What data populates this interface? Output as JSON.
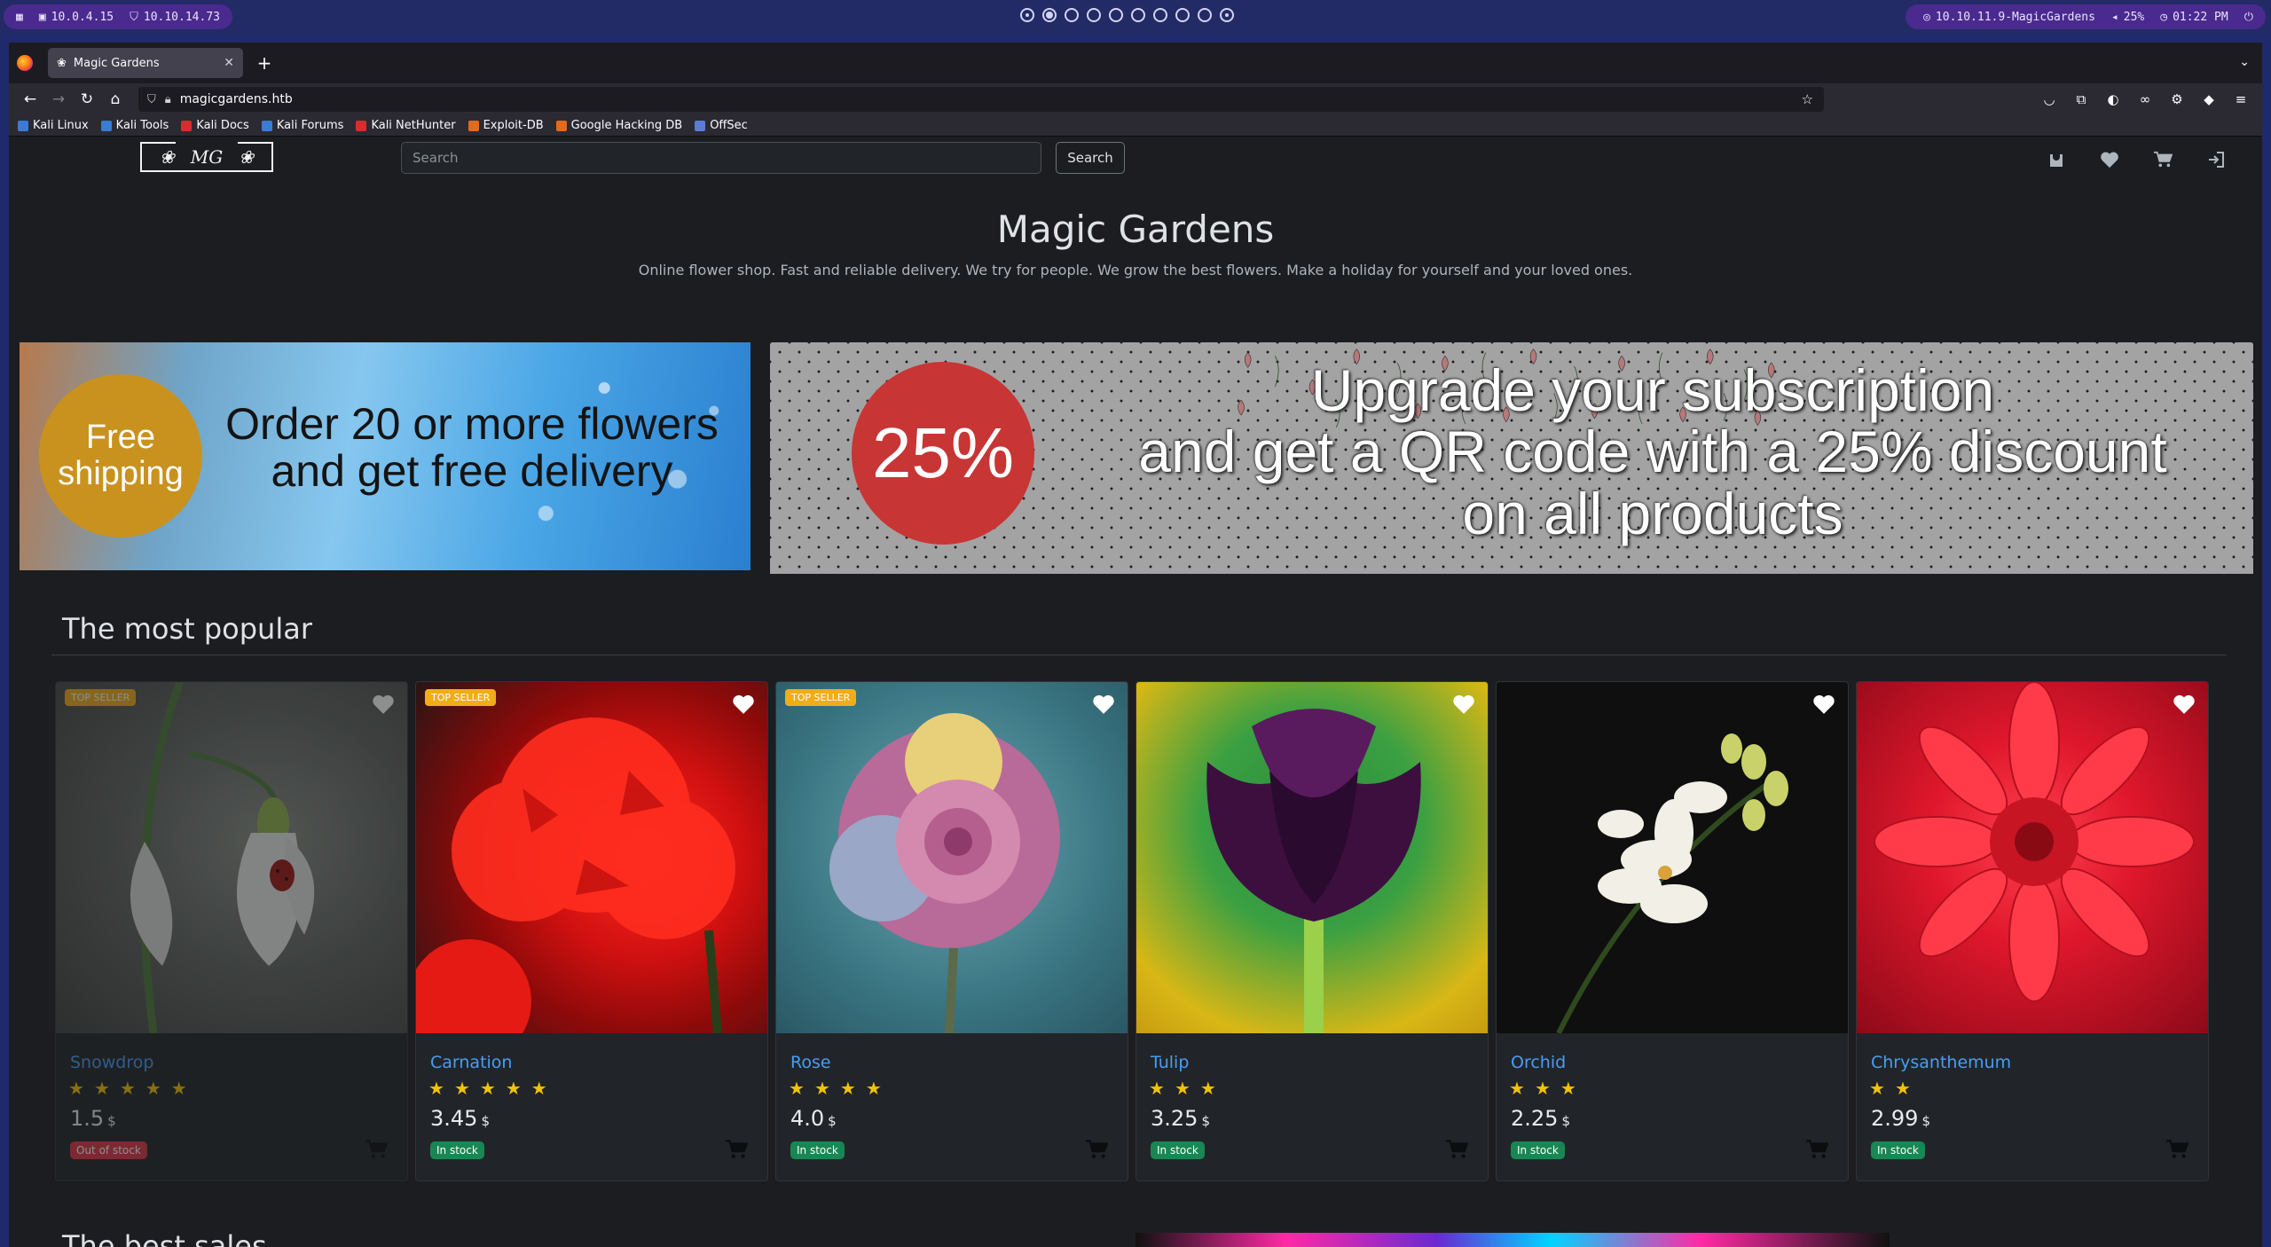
{
  "system": {
    "left_ips": [
      "10.0.4.15",
      "10.10.14.73"
    ],
    "target": "10.10.11.9-MagicGardens",
    "volume": "25%",
    "time": "01:22 PM"
  },
  "browser": {
    "tab_title": "Magic Gardens",
    "url": "magicgardens.htb",
    "bookmarks": [
      "Kali Linux",
      "Kali Tools",
      "Kali Docs",
      "Kali Forums",
      "Kali NetHunter",
      "Exploit-DB",
      "Google Hacking DB",
      "OffSec"
    ]
  },
  "site": {
    "search_placeholder": "Search",
    "search_button": "Search",
    "logo_text": "MG",
    "title": "Magic Gardens",
    "subtitle": "Online flower shop. Fast and reliable delivery. We try for people. We grow the best flowers. Make a holiday for yourself and your loved ones.",
    "banner_free": {
      "circle_line1": "Free",
      "circle_line2": "shipping",
      "text_line1": "Order 20 or more flowers",
      "text_line2": "and get free delivery"
    },
    "banner_sub": {
      "circle": "25%",
      "text_line1": "Upgrade your subscription",
      "text_line2": "and get a QR code with a 25% discount",
      "text_line3": "on all products"
    },
    "section_title": "The most popular",
    "next_section_title": "The best sales"
  },
  "products": [
    {
      "name": "Snowdrop",
      "rating": 5,
      "price": "1.5",
      "currency": "$",
      "stock": "Out of stock",
      "top_seller": "TOP SELLER",
      "badge": true,
      "in_stock": false
    },
    {
      "name": "Carnation",
      "rating": 5,
      "price": "3.45",
      "currency": "$",
      "stock": "In stock",
      "top_seller": "TOP SELLER",
      "badge": true,
      "in_stock": true
    },
    {
      "name": "Rose",
      "rating": 4,
      "price": "4.0",
      "currency": "$",
      "stock": "In stock",
      "top_seller": "TOP SELLER",
      "badge": true,
      "in_stock": true
    },
    {
      "name": "Tulip",
      "rating": 3,
      "price": "3.25",
      "currency": "$",
      "stock": "In stock",
      "top_seller": "",
      "badge": false,
      "in_stock": true
    },
    {
      "name": "Orchid",
      "rating": 3,
      "price": "2.25",
      "currency": "$",
      "stock": "In stock",
      "top_seller": "",
      "badge": false,
      "in_stock": true
    },
    {
      "name": "Chrysanthemum",
      "rating": 2,
      "price": "2.99",
      "currency": "$",
      "stock": "In stock",
      "top_seller": "",
      "badge": false,
      "in_stock": true
    }
  ],
  "colors": {
    "accent_link": "#4a9df2",
    "star": "#f2c200",
    "in_stock": "#198754",
    "out_of_stock": "#dc3545",
    "top_seller": "#f0ad1a"
  }
}
